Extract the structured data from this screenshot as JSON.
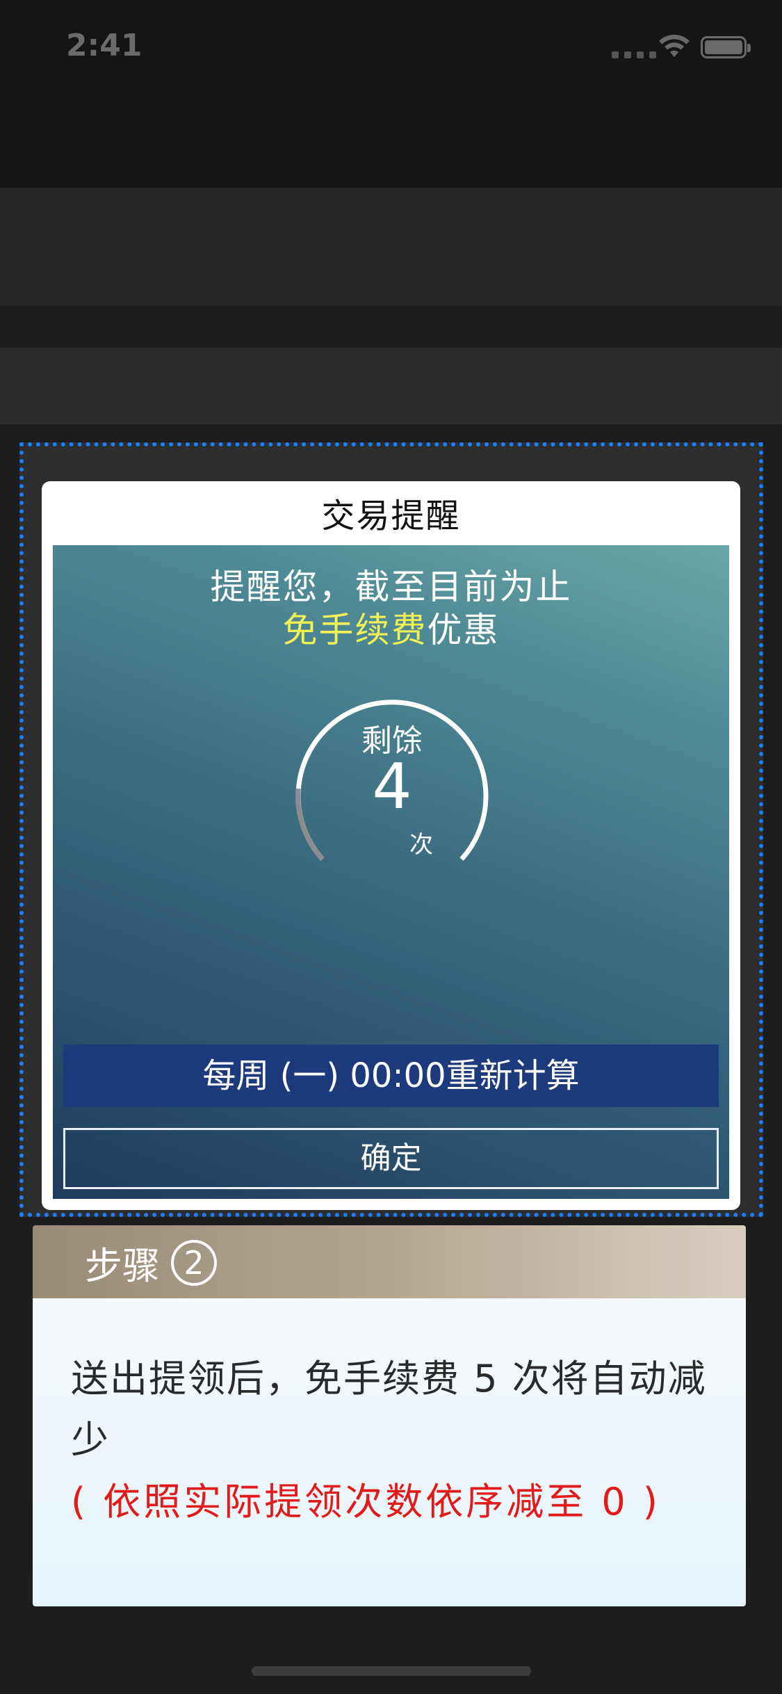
{
  "status_bar": {
    "time": "2:41"
  },
  "dialog": {
    "title": "交易提醒",
    "line1": "提醒您，截至目前为止",
    "line2_highlight": "免手续费",
    "line2_rest": "优惠",
    "ring": {
      "label": "剩馀",
      "count": "4",
      "unit": "次"
    },
    "reset_text": "每周 (一) 00:00重新计算",
    "confirm_label": "确定"
  },
  "step": {
    "title": "步骤",
    "number": "2",
    "body": "送出提领后，免手续费 5 次将自动减少",
    "note": "( 依照实际提领次数依序减至 0 )"
  },
  "colors": {
    "highlight_border": "#1a7fff",
    "highlight_text": "#f1f156",
    "note_red": "#e21a1a",
    "reset_bar": "#1d3a7c"
  }
}
